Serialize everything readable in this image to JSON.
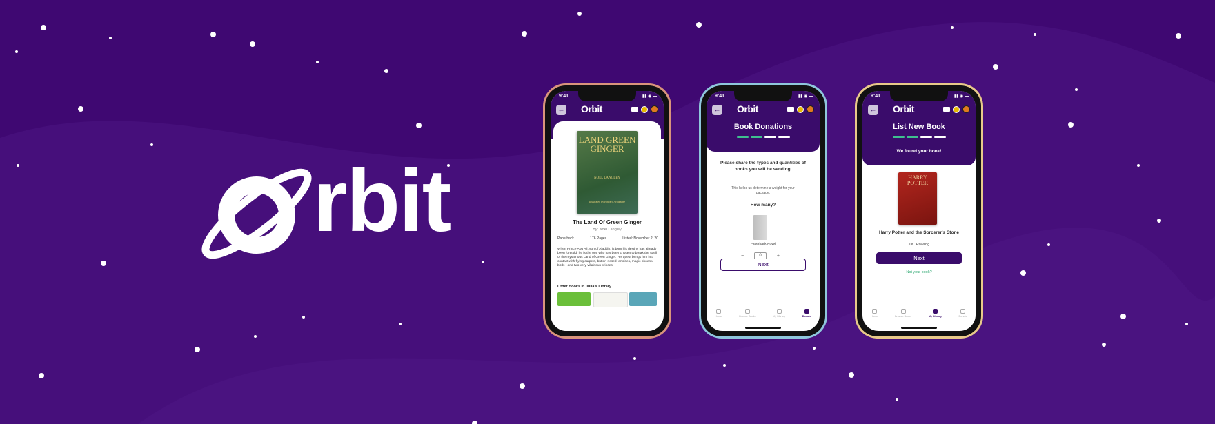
{
  "brand": {
    "logo_text": "rbit",
    "app_name": "Orbit"
  },
  "colors": {
    "background": "#3f0872",
    "header": "#3a0c6b",
    "accent_green": "#3fbf8f"
  },
  "status_bar": {
    "time": "9:41"
  },
  "phone1": {
    "cover": {
      "title": "LAND GREEN GINGER",
      "author": "NOEL LANGLEY",
      "illustrator": "Illustrated by Edward Ardizzone"
    },
    "title": "The Land Of Green Ginger",
    "author": "By: Noel Langley",
    "format": "Paperback",
    "pages": "176 Pages",
    "listed": "Listed: November 2, 20",
    "description": "When Prince Abu Ali, son of Aladdin, is born his destiny has already been foretold: he is the one who has been chosen to break the spell of the mysterious Land of Green Ginger. His quest brings him into contact with flying carpets, button-nosed tortoises, magic phoenix birds - and two very villainous princes.",
    "other_books_label": "Other Books In Julia's Library"
  },
  "phone2": {
    "title": "Book Donations",
    "intro": "Please share the types and quantities of books you will be sending.",
    "note": "This helps us determine a weight for your package.",
    "how_many": "How many?",
    "book_type": "Paperback Novel",
    "quantity": "0",
    "next_label": "Next",
    "tabs": [
      {
        "label": "Home",
        "icon": "home-icon"
      },
      {
        "label": "Browse Books",
        "icon": "search-icon"
      },
      {
        "label": "My Library",
        "icon": "library-icon"
      },
      {
        "label": "Donate",
        "icon": "donate-icon"
      }
    ],
    "active_tab": "Donate"
  },
  "phone3": {
    "title": "List New Book",
    "found_text": "We found your book!",
    "cover": {
      "text": "HARRY POTTER"
    },
    "book_title": "Harry Potter and the Sorcerer's Stone",
    "book_author": "J.K. Rowling",
    "next_label": "Next",
    "not_your_book": "Not your book?",
    "tabs": [
      {
        "label": "Home",
        "icon": "home-icon"
      },
      {
        "label": "Browse Books",
        "icon": "search-icon"
      },
      {
        "label": "My Library",
        "icon": "library-icon"
      },
      {
        "label": "Donate",
        "icon": "donate-icon"
      }
    ],
    "active_tab": "My Library"
  }
}
